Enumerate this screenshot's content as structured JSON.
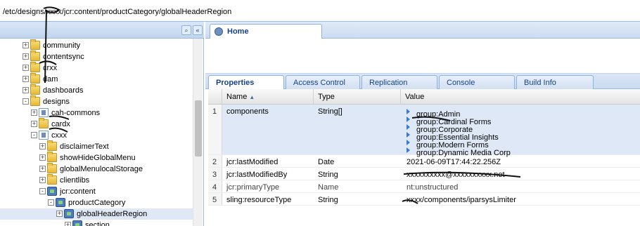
{
  "address_bar": {
    "path": "/etc/designs/xxxx/jcr:content/productCategory/globalHeaderRegion"
  },
  "left_panel": {
    "tree": [
      {
        "label": "community",
        "indent": 1,
        "icon": "folder-icon",
        "expander": "+"
      },
      {
        "label": "contentsync",
        "indent": 1,
        "icon": "folder-icon",
        "expander": "+"
      },
      {
        "label": "crxx",
        "indent": 1,
        "icon": "folder-icon",
        "expander": "+"
      },
      {
        "label": "dam",
        "indent": 1,
        "icon": "folder-icon",
        "expander": "+"
      },
      {
        "label": "dashboards",
        "indent": 1,
        "icon": "folder-icon",
        "expander": "+"
      },
      {
        "label": "designs",
        "indent": 1,
        "icon": "folder-icon",
        "expander": "-"
      },
      {
        "label": "cah-commons",
        "indent": 2,
        "icon": "page-icon",
        "expander": "+"
      },
      {
        "label": "cardx",
        "indent": 2,
        "icon": "folder-icon",
        "expander": "+"
      },
      {
        "label": "cxxx",
        "indent": 2,
        "icon": "page-icon",
        "expander": "-"
      },
      {
        "label": "disclaimerText",
        "indent": 3,
        "icon": "folder-icon",
        "expander": "+"
      },
      {
        "label": "showHideGlobalMenu",
        "indent": 3,
        "icon": "folder-icon",
        "expander": "+"
      },
      {
        "label": "globalMenulocalStorage",
        "indent": 3,
        "icon": "folder-icon",
        "expander": "+"
      },
      {
        "label": "clientlibs",
        "indent": 3,
        "icon": "folder-icon",
        "expander": "+"
      },
      {
        "label": "jcr:content",
        "indent": 3,
        "icon": "node-icon",
        "expander": "-"
      },
      {
        "label": "productCategory",
        "indent": 4,
        "icon": "node-icon",
        "expander": "-"
      },
      {
        "label": "globalHeaderRegion",
        "indent": 5,
        "icon": "node-icon",
        "expander": "+",
        "selected": true
      },
      {
        "label": "section",
        "indent": 6,
        "icon": "node-icon",
        "expander": "+"
      }
    ]
  },
  "right_panel": {
    "home_tab": "Home",
    "tabs": [
      "Properties",
      "Access Control",
      "Replication",
      "Console",
      "Build Info"
    ],
    "active_tab": "Properties",
    "grid": {
      "columns": [
        "Name",
        "Type",
        "Value"
      ],
      "sort_indicator": "▲",
      "rows": [
        {
          "index": "1",
          "name": "components",
          "type": "String[]",
          "values": [
            "group:Admin",
            "group:Cardinal Forms",
            "group:Corporate",
            "group:Essential Insights",
            "group:Modern Forms",
            "group:Dynamic Media Corp"
          ]
        },
        {
          "index": "2",
          "name": "jcr:lastModified",
          "type": "Date",
          "value": "2021-06-09T17:44:22.256Z"
        },
        {
          "index": "3",
          "name": "jcr:lastModifiedBy",
          "type": "String",
          "value": "xxxxxxxxxx@xxxxxxxxxx.net"
        },
        {
          "index": "4",
          "name": "jcr:primaryType",
          "type": "Name",
          "value": "nt:unstructured"
        },
        {
          "index": "5",
          "name": "sling:resourceType",
          "type": "String",
          "value": "xxxx/components/iparsysLimiter"
        }
      ]
    }
  },
  "colors": {
    "accent": "#15428b",
    "header": "#c1d5ef",
    "selection": "#dfe8f6"
  }
}
